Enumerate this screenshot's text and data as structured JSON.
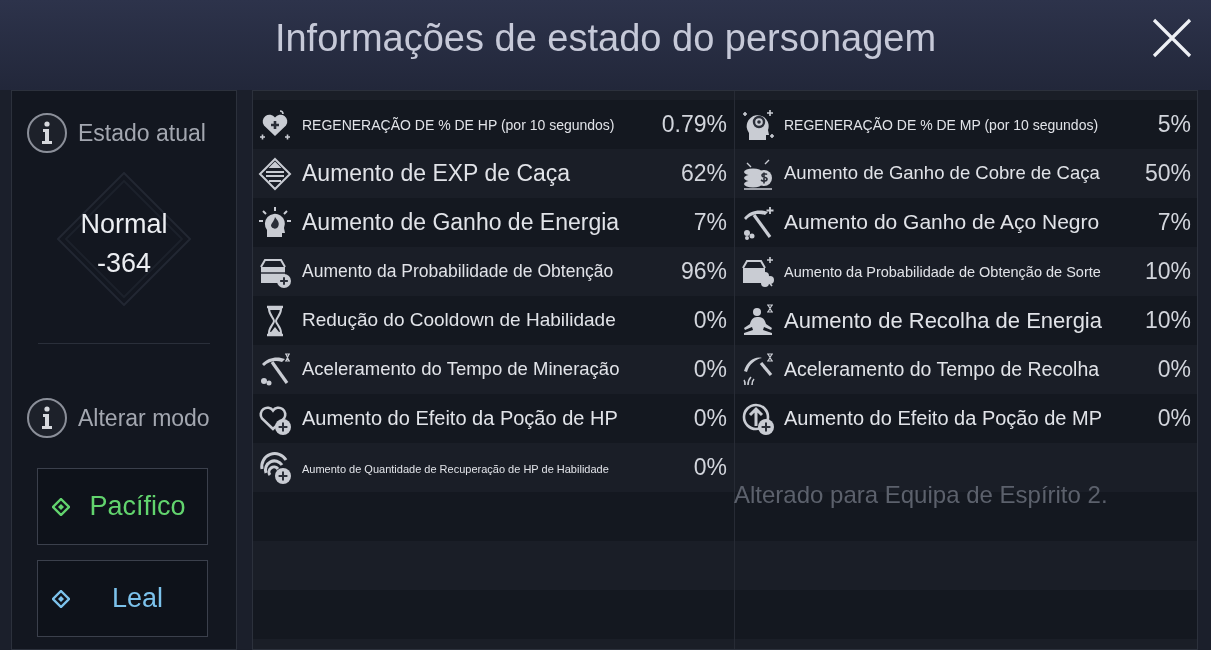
{
  "window": {
    "title": "Informações de estado do personagem"
  },
  "current_state": {
    "heading": "Estado atual",
    "status": "Normal",
    "value": "-364"
  },
  "mode": {
    "heading": "Alterar modo",
    "options": [
      {
        "label": "Pacífico",
        "color": "#62d46e"
      },
      {
        "label": "Leal",
        "color": "#7cc2ec"
      }
    ]
  },
  "stat_columns": [
    [
      {
        "label": "REGENERAÇÃO DE % DE HP (por 10 segundos)",
        "value": "0.79%"
      },
      {
        "label": "Aumento de EXP de Caça",
        "value": "62%"
      },
      {
        "label": "Aumento de Ganho de Energia",
        "value": "7%"
      },
      {
        "label": "Aumento da Probabilidade de Obtenção",
        "value": "96%"
      },
      {
        "label": "Redução do Cooldown de Habilidade",
        "value": "0%"
      },
      {
        "label": "Aceleramento do Tempo de Mineração",
        "value": "0%"
      },
      {
        "label": "Aumento do Efeito da Poção de HP",
        "value": "0%"
      },
      {
        "label": "Aumento de Quantidade de Recuperação de HP de Habilidade",
        "value": "0%"
      }
    ],
    [
      {
        "label": "REGENERAÇÃO DE % DE MP (por 10 segundos)",
        "value": "5%"
      },
      {
        "label": "Aumento de Ganho de Cobre de Caça",
        "value": "50%"
      },
      {
        "label": "Aumento do Ganho de Aço Negro",
        "value": "7%"
      },
      {
        "label": "Aumento da Probabilidade de Obtenção de Sorte",
        "value": "10%"
      },
      {
        "label": "Aumento de Recolha de Energia",
        "value": "10%"
      },
      {
        "label": "Aceleramento do Tempo de Recolha",
        "value": "0%"
      },
      {
        "label": "Aumento do Efeito da Poção de MP",
        "value": "0%"
      }
    ]
  ],
  "toast": "Alterado para Equipa de Espírito 2."
}
